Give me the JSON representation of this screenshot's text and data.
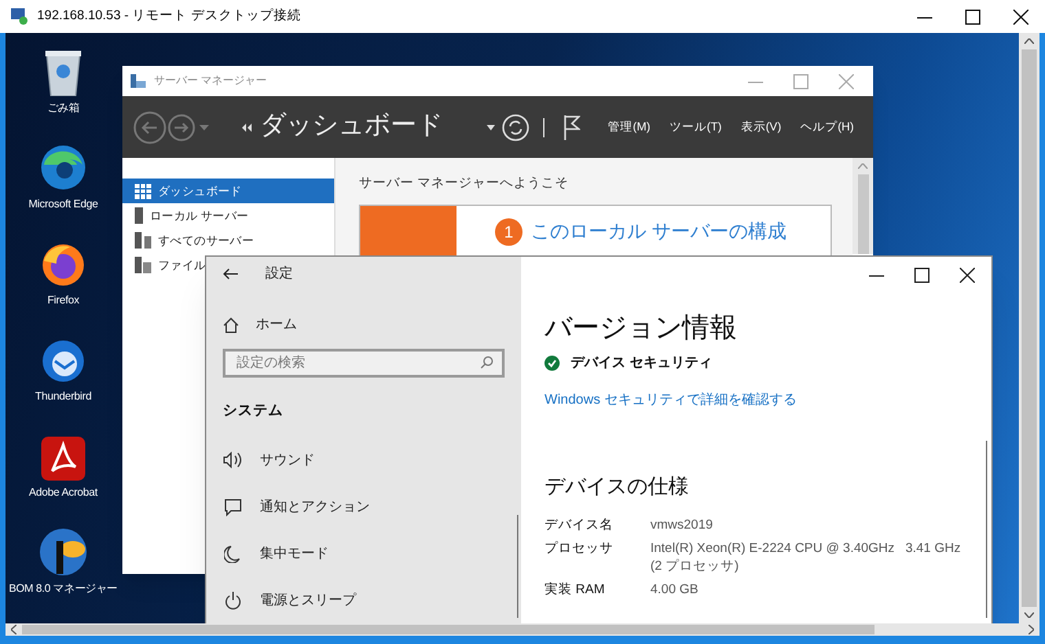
{
  "rdp_window": {
    "title": "192.168.10.53 - リモート デスクトップ接続"
  },
  "desktop_icons": [
    {
      "label": "ごみ箱",
      "kind": "recycle"
    },
    {
      "label": "Microsoft Edge",
      "kind": "edge"
    },
    {
      "label": "Firefox",
      "kind": "firefox"
    },
    {
      "label": "Thunderbird",
      "kind": "thunderbird"
    },
    {
      "label": "Adobe Acrobat",
      "kind": "acrobat"
    },
    {
      "label": "BOM 8.0 マネージャー",
      "kind": "bom"
    }
  ],
  "server_manager": {
    "title": "サーバー マネージャー",
    "page_title": "ダッシュボード",
    "menus": [
      "管理(M)",
      "ツール(T)",
      "表示(V)",
      "ヘルプ(H)"
    ],
    "nav": [
      {
        "label": "ダッシュボード",
        "selected": true,
        "kind": "dashboard"
      },
      {
        "label": "ローカル サーバー",
        "selected": false,
        "kind": "server"
      },
      {
        "label": "すべてのサーバー",
        "selected": false,
        "kind": "servers"
      },
      {
        "label": "ファイル",
        "selected": false,
        "kind": "files"
      }
    ],
    "welcome": "サーバー マネージャーへようこそ",
    "step_number": "1",
    "step_link": "このローカル サーバーの構成"
  },
  "settings": {
    "title": "設定",
    "home": "ホーム",
    "search": {
      "placeholder": "設定の検索"
    },
    "section": "システム",
    "items": [
      {
        "label": "サウンド",
        "kind": "sound"
      },
      {
        "label": "通知とアクション",
        "kind": "notification"
      },
      {
        "label": "集中モード",
        "kind": "focus"
      },
      {
        "label": "電源とスリープ",
        "kind": "power"
      }
    ],
    "heading": "バージョン情報",
    "security": "デバイス セキュリティ",
    "security_link": "Windows セキュリティで詳細を確認する",
    "specs_heading": "デバイスの仕様",
    "specs": [
      {
        "label": "デバイス名",
        "value": "vmws2019"
      },
      {
        "label": "プロセッサ",
        "value": "Intel(R) Xeon(R) E-2224 CPU @ 3.40GHz   3.41 GHz",
        "value_line2": "(2 プロセッサ)"
      },
      {
        "label": "実装 RAM",
        "value": "4.00 GB"
      }
    ]
  }
}
